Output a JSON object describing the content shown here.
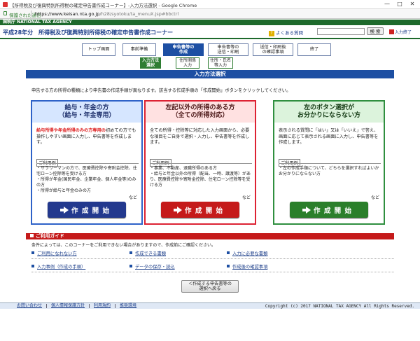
{
  "browser": {
    "title": "【所得税及び復興特別所得税の確定申告書作成コーナー】-入力方法選択 - Google Chrome",
    "secure_label": "保護された通信",
    "url_host": "https://www.keisan.nta.go.jp",
    "url_path": "/h28/syotoku/ta_menuX.jsp#bbctrl",
    "window_buttons": [
      "—",
      "□",
      "✕"
    ]
  },
  "site": {
    "brand": "国税庁 NATIONAL TAX AGENCY",
    "title": "平成28年分　所得税及び復興特別所得税の確定申告書作成コーナー",
    "faq_label": "よくある質問",
    "search_placeholder": "",
    "search_button": "検 索",
    "howto_label": "入力終了"
  },
  "steps": [
    {
      "label": "トップ画面"
    },
    {
      "label": "事前準備"
    },
    {
      "label": "申告書等の\n作成"
    },
    {
      "label": "申告書等の\n送信・印刷"
    },
    {
      "label": "送信・印刷後\nの確認事項"
    },
    {
      "label": "終了"
    }
  ],
  "substeps": [
    {
      "label": "入力方法\n選択"
    },
    {
      "label": "住所関係\n入力"
    },
    {
      "label": "住所・氏名\n等入力"
    }
  ],
  "section_title": "入力方法選択",
  "intro_text": "申告する方の所得の種類により申告書の作成手順が異なります。該当する作成手順の「作成開始」ボタンをクリックしてください。",
  "panels": {
    "salary": {
      "title1": "給与・年金の方",
      "title2": "（給与・年金専用）",
      "desc_em": "給与所得や年金所得のみの方専用の",
      "desc": "初めての方でも操作しやすい画面に入力し、申告書等を作成します。",
      "example_label": "ご利用例",
      "items": [
        "・サラリーマンの方で、医療費控除や寄附金控除、住宅ローン控除等を受ける方",
        "・所得が年金(国民年金、企業年金、個人年金等)のみの方",
        "・所得が給与と年金のみの方"
      ],
      "nado": "など",
      "button": "作 成 開 始"
    },
    "other": {
      "title1": "左記以外の所得のある方",
      "title2": "（全ての所得対応）",
      "desc": "全ての所得・控除等に対応した入力画面から、必要な項目をご自身で選択・入力し、申告書等を作成します。",
      "example_label": "ご利用例",
      "items": [
        "・事業、不動産、退職所得のある方",
        "・給与と年金以外の所得（配当、一時、譲渡等）があり、医療費控除や寄附金控除、住宅ローン控除等を受ける方"
      ],
      "nado": "など",
      "button": "作 成 開 始"
    },
    "unknown": {
      "title1": "左のボタン選択が",
      "title2": "お分かりにならない方",
      "desc": "表示される質問に「はい」又は「いいえ」で答え、画面に応じて表示される画面に入力し、申告書等を作成します。",
      "example_label": "ご利用例",
      "items": [
        "・左の作成手順について、どちらを選択すればよいかお分かりにならない方"
      ],
      "nado": "など",
      "button": "作 成 開 始"
    }
  },
  "guide": {
    "title": "ご利用ガイド",
    "note": "条件によっては、このコーナーをご利用できない場合がありますので、作成前にご確認ください。",
    "links": [
      "ご利用になれない方",
      "作成できる書類",
      "入力に必要な書類",
      "入力事例（作成の手順）",
      "データの保存・読込",
      "作成後の確認事項"
    ]
  },
  "back_button": "＜作成する申告書等の\n選択へ戻る",
  "footer": {
    "links": [
      "お問い合わせ",
      "個人情報保護方針",
      "利用規約",
      "推奨環境"
    ],
    "copyright": "Copyright (c) 2017 NATIONAL TAX AGENCY All Rights Reserved."
  }
}
